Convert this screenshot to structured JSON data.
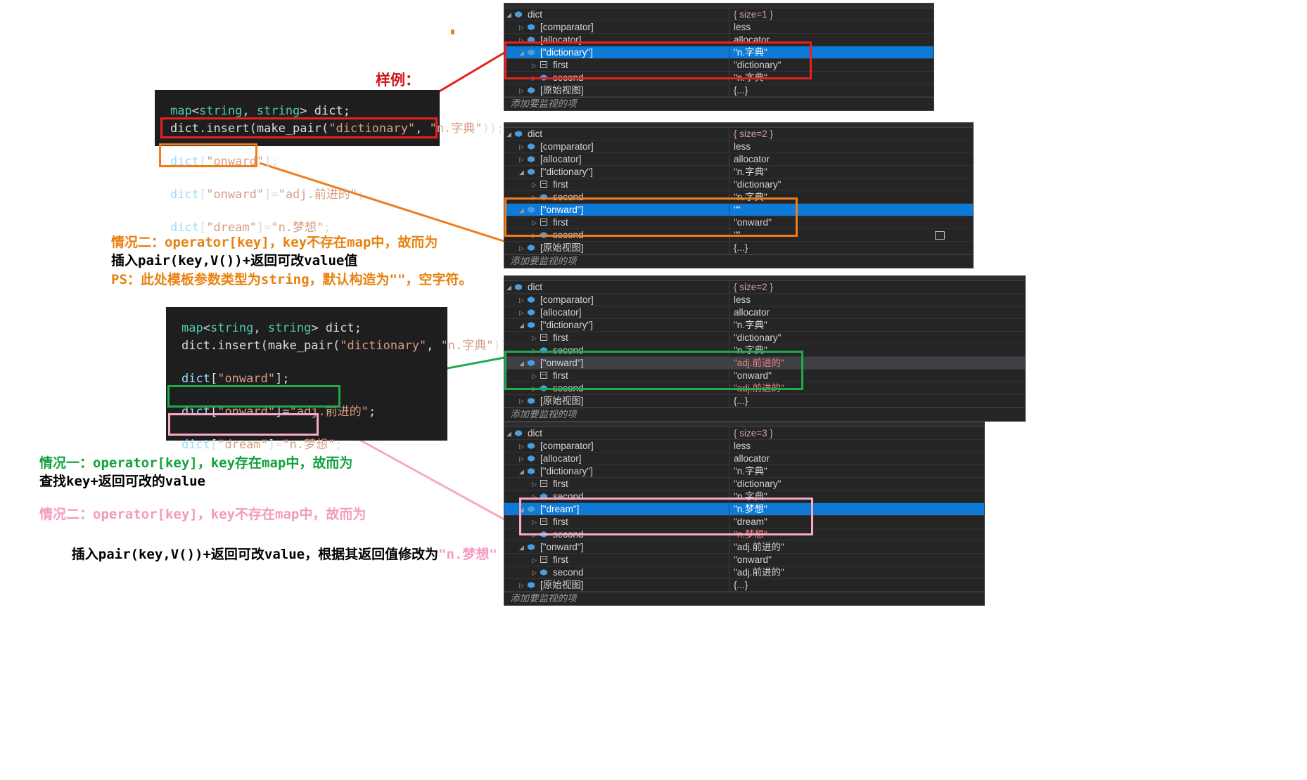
{
  "annotations": {
    "sample_label": "样例：",
    "case2_a_line1": "情况二：operator[key]，key不存在map中，故而为",
    "case2_a_line2": "插入pair(key,V())+返回可改value值",
    "case2_a_ps": "PS：此处模板参数类型为string，默认构造为\"\"，空字符。",
    "case1_line1": "情况一：operator[key]，key存在map中，故而为",
    "case1_line2": "查找key+返回可改的value",
    "case2_b_line1": "情况二：operator[key]，key不存在map中，故而为",
    "case2_b_line2_pre": "插入pair(key,V())+返回可改value，根据其返回值修改为",
    "case2_b_line2_quoted": "\"n.梦想\""
  },
  "code_blocks": [
    {
      "id": "code-top",
      "lines": [
        {
          "segments": [
            {
              "t": "map",
              "c": "type"
            },
            {
              "t": "<",
              "c": "punct"
            },
            {
              "t": "string",
              "c": "type"
            },
            {
              "t": ", ",
              "c": "punct"
            },
            {
              "t": "string",
              "c": "type"
            },
            {
              "t": "> ",
              "c": "punct"
            },
            {
              "t": "dict",
              "c": "plain"
            },
            {
              "t": ";",
              "c": "punct"
            }
          ]
        },
        {
          "segments": [
            {
              "t": "dict",
              "c": "plain"
            },
            {
              "t": ".",
              "c": "punct"
            },
            {
              "t": "insert",
              "c": "plain"
            },
            {
              "t": "(",
              "c": "punct"
            },
            {
              "t": "make_pair",
              "c": "plain"
            },
            {
              "t": "(",
              "c": "punct"
            },
            {
              "t": "\"dictionary\"",
              "c": "str"
            },
            {
              "t": ", ",
              "c": "punct"
            },
            {
              "t": "\"n.字典\"",
              "c": "str"
            },
            {
              "t": "));",
              "c": "punct"
            }
          ]
        },
        {
          "blank": true
        },
        {
          "segments": [
            {
              "t": "dict",
              "c": "var"
            },
            {
              "t": "[",
              "c": "punct"
            },
            {
              "t": "\"onward\"",
              "c": "str"
            },
            {
              "t": "];",
              "c": "punct"
            }
          ]
        },
        {
          "blank": true
        },
        {
          "segments": [
            {
              "t": "dict",
              "c": "var"
            },
            {
              "t": "[",
              "c": "punct"
            },
            {
              "t": "\"onward\"",
              "c": "str"
            },
            {
              "t": "]=",
              "c": "punct"
            },
            {
              "t": "\"adj.前进的\"",
              "c": "str"
            },
            {
              "t": ";",
              "c": "punct"
            }
          ]
        },
        {
          "blank": true
        },
        {
          "segments": [
            {
              "t": "dict",
              "c": "var"
            },
            {
              "t": "[",
              "c": "punct"
            },
            {
              "t": "\"dream\"",
              "c": "str"
            },
            {
              "t": "]=",
              "c": "punct"
            },
            {
              "t": "\"n.梦想\"",
              "c": "str"
            },
            {
              "t": ";",
              "c": "punct"
            }
          ]
        }
      ]
    },
    {
      "id": "code-bottom",
      "lines": [
        {
          "segments": [
            {
              "t": "map",
              "c": "type"
            },
            {
              "t": "<",
              "c": "punct"
            },
            {
              "t": "string",
              "c": "type"
            },
            {
              "t": ", ",
              "c": "punct"
            },
            {
              "t": "string",
              "c": "type"
            },
            {
              "t": "> ",
              "c": "punct"
            },
            {
              "t": "dict",
              "c": "plain"
            },
            {
              "t": ";",
              "c": "punct"
            }
          ]
        },
        {
          "segments": [
            {
              "t": "dict",
              "c": "plain"
            },
            {
              "t": ".",
              "c": "punct"
            },
            {
              "t": "insert",
              "c": "plain"
            },
            {
              "t": "(",
              "c": "punct"
            },
            {
              "t": "make_pair",
              "c": "plain"
            },
            {
              "t": "(",
              "c": "punct"
            },
            {
              "t": "\"dictionary\"",
              "c": "str"
            },
            {
              "t": ", ",
              "c": "punct"
            },
            {
              "t": "\"n.字典\"",
              "c": "str"
            },
            {
              "t": "));",
              "c": "punct"
            }
          ]
        },
        {
          "blank": true
        },
        {
          "segments": [
            {
              "t": "dict",
              "c": "var"
            },
            {
              "t": "[",
              "c": "punct"
            },
            {
              "t": "\"onward\"",
              "c": "str"
            },
            {
              "t": "];",
              "c": "punct"
            }
          ]
        },
        {
          "blank": true
        },
        {
          "segments": [
            {
              "t": "dict",
              "c": "var"
            },
            {
              "t": "[",
              "c": "punct"
            },
            {
              "t": "\"onward\"",
              "c": "str"
            },
            {
              "t": "]=",
              "c": "punct"
            },
            {
              "t": "\"adj.前进的\"",
              "c": "str"
            },
            {
              "t": ";",
              "c": "punct"
            }
          ]
        },
        {
          "blank": true
        },
        {
          "segments": [
            {
              "t": "dict",
              "c": "var"
            },
            {
              "t": "[",
              "c": "punct"
            },
            {
              "t": "\"dream\"",
              "c": "str"
            },
            {
              "t": "]=",
              "c": "punct"
            },
            {
              "t": "\"n.梦想\"",
              "c": "str"
            },
            {
              "t": ";",
              "c": "punct"
            }
          ]
        }
      ]
    }
  ],
  "watch_footer_label": "添加要监视的项",
  "watch_panels": [
    {
      "id": "watch-1",
      "rows": [
        {
          "indent": 1,
          "arrow": "expanded",
          "icon": "cube",
          "name": "dict",
          "value": "{ size=1 }",
          "value_style": "sizetag"
        },
        {
          "indent": 2,
          "arrow": "collapsed",
          "icon": "cube",
          "name": "[comparator]",
          "value": "less"
        },
        {
          "indent": 2,
          "arrow": "collapsed",
          "icon": "cube",
          "name": "[allocator]",
          "value": "allocator"
        },
        {
          "indent": 2,
          "arrow": "expanded",
          "icon": "cube",
          "name": "[\"dictionary\"]",
          "value": "\"n.字典\"",
          "selected": true
        },
        {
          "indent": 3,
          "arrow": "collapsed",
          "icon": "field",
          "name": "first",
          "value": "\"dictionary\""
        },
        {
          "indent": 3,
          "arrow": "collapsed",
          "icon": "cube",
          "name": "second",
          "value": "\"n.字典\""
        },
        {
          "indent": 2,
          "arrow": "collapsed",
          "icon": "cube",
          "name": "[原始视图]",
          "value": "{...}"
        }
      ]
    },
    {
      "id": "watch-2",
      "rows": [
        {
          "indent": 1,
          "arrow": "expanded",
          "icon": "cube",
          "name": "dict",
          "value": "{ size=2 }",
          "value_style": "sizetag"
        },
        {
          "indent": 2,
          "arrow": "collapsed",
          "icon": "cube",
          "name": "[comparator]",
          "value": "less"
        },
        {
          "indent": 2,
          "arrow": "collapsed",
          "icon": "cube",
          "name": "[allocator]",
          "value": "allocator"
        },
        {
          "indent": 2,
          "arrow": "expanded",
          "icon": "cube",
          "name": "[\"dictionary\"]",
          "value": "\"n.字典\""
        },
        {
          "indent": 3,
          "arrow": "collapsed",
          "icon": "field",
          "name": "first",
          "value": "\"dictionary\""
        },
        {
          "indent": 3,
          "arrow": "collapsed",
          "icon": "cube",
          "name": "second",
          "value": "\"n.字典\""
        },
        {
          "indent": 2,
          "arrow": "expanded",
          "icon": "cube",
          "name": "[\"onward\"]",
          "value": "\"\"",
          "selected": true
        },
        {
          "indent": 3,
          "arrow": "collapsed",
          "icon": "field",
          "name": "first",
          "value": "\"onward\""
        },
        {
          "indent": 3,
          "arrow": "collapsed",
          "icon": "cube",
          "name": "second",
          "value": "\"\"",
          "magnifier": true
        },
        {
          "indent": 2,
          "arrow": "collapsed",
          "icon": "cube",
          "name": "[原始视图]",
          "value": "{...}"
        }
      ]
    },
    {
      "id": "watch-3",
      "rows": [
        {
          "indent": 1,
          "arrow": "expanded",
          "icon": "cube",
          "name": "dict",
          "value": "{ size=2 }",
          "value_style": "sizetag"
        },
        {
          "indent": 2,
          "arrow": "collapsed",
          "icon": "cube",
          "name": "[comparator]",
          "value": "less"
        },
        {
          "indent": 2,
          "arrow": "collapsed",
          "icon": "cube",
          "name": "[allocator]",
          "value": "allocator"
        },
        {
          "indent": 2,
          "arrow": "expanded",
          "icon": "cube",
          "name": "[\"dictionary\"]",
          "value": "\"n.字典\""
        },
        {
          "indent": 3,
          "arrow": "collapsed",
          "icon": "field",
          "name": "first",
          "value": "\"dictionary\""
        },
        {
          "indent": 3,
          "arrow": "collapsed",
          "icon": "cube",
          "name": "second",
          "value": "\"n.字典\""
        },
        {
          "indent": 2,
          "arrow": "expanded",
          "icon": "cube",
          "name": "[\"onward\"]",
          "value": "\"adj.前进的\"",
          "value_style": "modified",
          "selgray": true
        },
        {
          "indent": 3,
          "arrow": "collapsed",
          "icon": "field",
          "name": "first",
          "value": "\"onward\""
        },
        {
          "indent": 3,
          "arrow": "collapsed",
          "icon": "cube",
          "name": "second",
          "value": "\"adj.前进的\"",
          "value_style": "modified"
        },
        {
          "indent": 2,
          "arrow": "collapsed",
          "icon": "cube",
          "name": "[原始视图]",
          "value": "{...}"
        }
      ]
    },
    {
      "id": "watch-4",
      "rows": [
        {
          "indent": 1,
          "arrow": "expanded",
          "icon": "cube",
          "name": "dict",
          "value": "{ size=3 }",
          "value_style": "sizetag"
        },
        {
          "indent": 2,
          "arrow": "collapsed",
          "icon": "cube",
          "name": "[comparator]",
          "value": "less"
        },
        {
          "indent": 2,
          "arrow": "collapsed",
          "icon": "cube",
          "name": "[allocator]",
          "value": "allocator"
        },
        {
          "indent": 2,
          "arrow": "expanded",
          "icon": "cube",
          "name": "[\"dictionary\"]",
          "value": "\"n.字典\""
        },
        {
          "indent": 3,
          "arrow": "collapsed",
          "icon": "field",
          "name": "first",
          "value": "\"dictionary\""
        },
        {
          "indent": 3,
          "arrow": "collapsed",
          "icon": "cube",
          "name": "second",
          "value": "\"n.字典\""
        },
        {
          "indent": 2,
          "arrow": "expanded",
          "icon": "cube",
          "name": "[\"dream\"]",
          "value": "\"n.梦想\"",
          "value_style": "modified",
          "selected": true
        },
        {
          "indent": 3,
          "arrow": "collapsed",
          "icon": "field",
          "name": "first",
          "value": "\"dream\""
        },
        {
          "indent": 3,
          "arrow": "collapsed",
          "icon": "cube",
          "name": "second",
          "value": "\"n.梦想\"",
          "value_style": "modified"
        },
        {
          "indent": 2,
          "arrow": "expanded",
          "icon": "cube",
          "name": "[\"onward\"]",
          "value": "\"adj.前进的\""
        },
        {
          "indent": 3,
          "arrow": "collapsed",
          "icon": "field",
          "name": "first",
          "value": "\"onward\""
        },
        {
          "indent": 3,
          "arrow": "collapsed",
          "icon": "cube",
          "name": "second",
          "value": "\"adj.前进的\""
        },
        {
          "indent": 2,
          "arrow": "collapsed",
          "icon": "cube",
          "name": "[原始视图]",
          "value": "{...}"
        }
      ]
    }
  ],
  "colors": {
    "red": "#e8201f",
    "orange": "#f07c1c",
    "green": "#1faa4b",
    "pink": "#f7a9c6",
    "selection_blue": "#0d7ad8",
    "modified_value": "#f08080"
  }
}
